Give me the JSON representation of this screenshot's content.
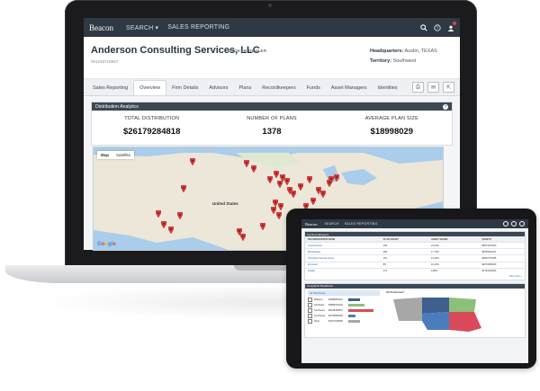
{
  "app": {
    "logo": "Beacon",
    "nav": {
      "search_label": "SEARCH",
      "search_chevron": "chevron-down-icon",
      "sales_reporting_label": "SALES REPORTING"
    },
    "nav_icons": [
      "search-icon",
      "help-icon",
      "notification-icon"
    ]
  },
  "firm": {
    "name": "Anderson Consulting Services, LLC",
    "type": "BROKER-DEALER",
    "id": "0512497109S7",
    "headquarters_label": "Headquarters:",
    "headquarters_value": "Austin, TEXAS",
    "territory_label": "Territory:",
    "territory_value": "Southwest"
  },
  "tabs": [
    {
      "label": "Sales Reporting"
    },
    {
      "label": "Overview"
    },
    {
      "label": "Firm Details"
    },
    {
      "label": "Advisors"
    },
    {
      "label": "Plans"
    },
    {
      "label": "Recordkeepers"
    },
    {
      "label": "Funds"
    },
    {
      "label": "Asset Managers"
    },
    {
      "label": "Identities"
    }
  ],
  "tab_actions": [
    "print-icon",
    "email-icon",
    "export-icon"
  ],
  "distribution": {
    "title": "Distribution Analytics",
    "metrics": [
      {
        "label": "TOTAL DISTRIBUTION",
        "value": "$26179284818"
      },
      {
        "label": "NUMBER OF PLANS",
        "value": "1378"
      },
      {
        "label": "AVERAGE PLAN SIZE",
        "value": "$18998029"
      }
    ]
  },
  "map": {
    "toggle": {
      "map": "Map",
      "satellite": "Satellite"
    },
    "labels": {
      "country": "United States"
    },
    "google": [
      "G",
      "o",
      "o",
      "g",
      "l",
      "e"
    ]
  },
  "tablet": {
    "logo": "Beacon",
    "nav": {
      "search_label": "SEARCH",
      "sales_reporting_label": "SALES REPORTING"
    },
    "recordkeepers": {
      "title": "Top Recordkeepers",
      "columns": [
        "RECORDKEEPER NAME",
        "PLAN COUNT",
        "ASSET SHARE",
        "ASSETS"
      ],
      "rows": [
        [
          "Transamerica",
          "196",
          "21.00%",
          "$5574431300"
        ],
        [
          "MassMutual",
          "289",
          "17.70%",
          "$4650932227"
        ],
        [
          "Principal Financial Group",
          "161",
          "13.40%",
          "$3502757208"
        ],
        [
          "Empower",
          "85",
          "10.20%",
          "$2670480180"
        ],
        [
          "Fidelity",
          "174",
          "6.80%",
          "$1781936933"
        ]
      ],
      "view_more": "View more »"
    },
    "geography": {
      "title": "Geographic Breakdown",
      "selected": "All Territories",
      "rows": [
        {
          "name": "Midwest",
          "value": "$4088060321",
          "color": "#3f5f8e",
          "fill": 0.45
        },
        {
          "name": "Northeast",
          "value": "$5889044232",
          "color": "#8cc07a",
          "fill": 0.65
        },
        {
          "name": "Southeast",
          "value": "$9138452816",
          "color": "#d94b5a",
          "fill": 1.0
        },
        {
          "name": "Southwest",
          "value": "$2735808484",
          "color": "#4a7dbd",
          "fill": 0.3
        },
        {
          "name": "West",
          "value": "$4327918965",
          "color": "#a7a7a7",
          "fill": 0.48
        }
      ],
      "map_title": "All Territories*"
    }
  }
}
